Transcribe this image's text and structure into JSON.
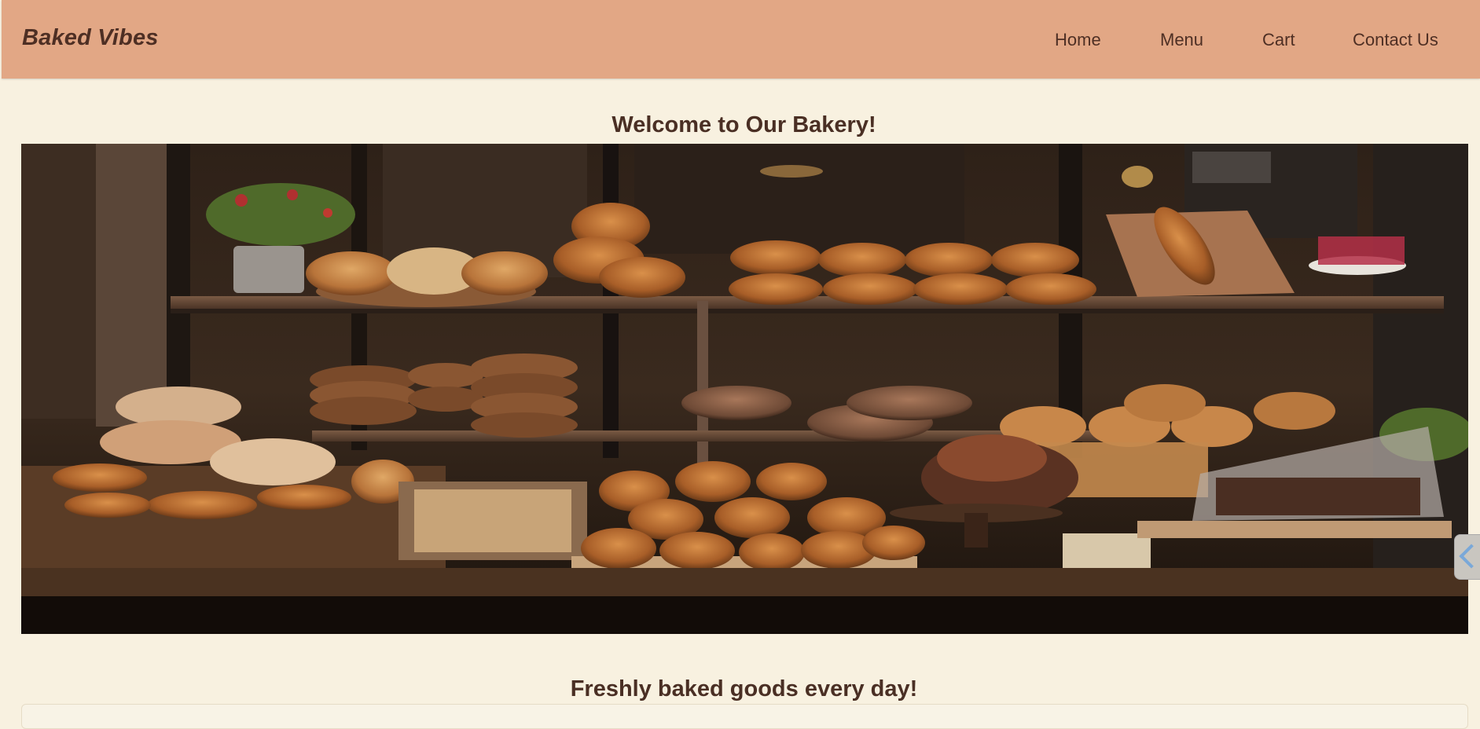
{
  "brand": "Baked Vibes",
  "nav": {
    "items": [
      {
        "label": "Home"
      },
      {
        "label": "Menu"
      },
      {
        "label": "Cart"
      },
      {
        "label": "Contact Us"
      }
    ]
  },
  "hero": {
    "heading": "Welcome to Our Bakery!",
    "subheading": "Freshly baked goods every day!"
  },
  "colors": {
    "navbar": "#e2a785",
    "page_background": "#f8f1e0",
    "text": "#4a2f24"
  }
}
